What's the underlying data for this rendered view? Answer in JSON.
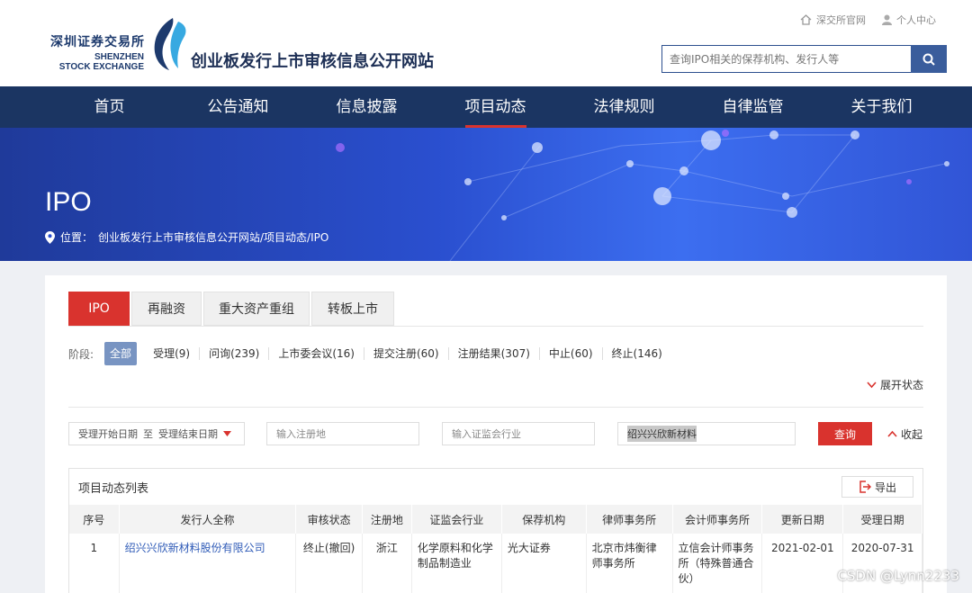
{
  "header": {
    "logo_cn": "深圳证券交易所",
    "logo_en_1": "SHENZHEN",
    "logo_en_2": "STOCK EXCHANGE",
    "site_title": "创业板发行上市审核信息公开网站",
    "top_links": [
      "深交所官网",
      "个人中心"
    ],
    "search_placeholder": "查询IPO相关的保荐机构、发行人等"
  },
  "nav": {
    "items": [
      "首页",
      "公告通知",
      "信息披露",
      "项目动态",
      "法律规则",
      "自律监管",
      "关于我们"
    ],
    "active": "项目动态"
  },
  "banner": {
    "title": "IPO",
    "breadcrumb_label": "位置：",
    "breadcrumb_path": "创业板发行上市审核信息公开网站/项目动态/IPO"
  },
  "tabs": [
    "IPO",
    "再融资",
    "重大资产重组",
    "转板上市"
  ],
  "stages": {
    "label": "阶段:",
    "all": "全部",
    "items": [
      "受理(9)",
      "问询(239)",
      "上市委会议(16)",
      "提交注册(60)",
      "注册结果(307)",
      "中止(60)",
      "终止(146)"
    ]
  },
  "expand_label": "展开状态",
  "filters": {
    "date_start": "受理开始日期",
    "date_sep": "至",
    "date_end": "受理结束日期",
    "reg_place": "输入注册地",
    "industry": "输入证监会行业",
    "keyword": "绍兴兴欣新材料",
    "query": "查询",
    "collapse": "收起"
  },
  "list": {
    "title": "项目动态列表",
    "export": "导出",
    "columns": [
      "序号",
      "发行人全称",
      "审核状态",
      "注册地",
      "证监会行业",
      "保荐机构",
      "律师事务所",
      "会计师事务所",
      "更新日期",
      "受理日期"
    ],
    "rows": [
      [
        "1",
        "绍兴兴欣新材料股份有限公司",
        "终止(撤回)",
        "浙江",
        "化学原料和化学制品制造业",
        "光大证券",
        "北京市炜衡律师事务所",
        "立信会计师事务所（特殊普通合伙）",
        "2021-02-01",
        "2020-07-31"
      ]
    ]
  },
  "watermark": "CSDN @Lynn2233",
  "colors": {
    "navy": "#1b3562",
    "accent": "#d9332e",
    "link": "#2f5bb7"
  }
}
